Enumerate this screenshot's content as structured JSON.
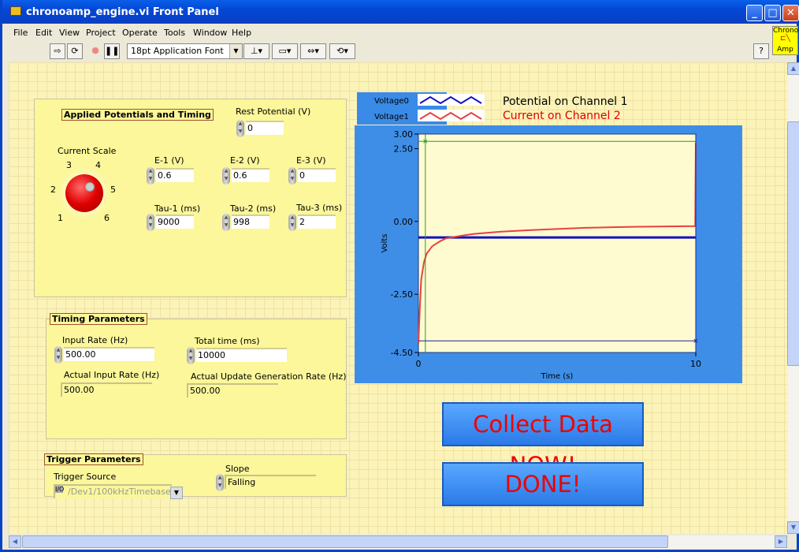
{
  "window": {
    "title": "chronoamp_engine.vi Front Panel"
  },
  "menu": [
    "File",
    "Edit",
    "View",
    "Project",
    "Operate",
    "Tools",
    "Window",
    "Help"
  ],
  "toolbar": {
    "font": "18pt Application Font",
    "help": "?"
  },
  "vi_icon": {
    "top": "Chrono",
    "bottom": "Amp"
  },
  "applied": {
    "title": "Applied Potentials and Timing",
    "rest_label": "Rest Potential (V)",
    "rest_value": "0",
    "knob": {
      "label": "Current Scale",
      "ticks": [
        "1",
        "2",
        "3",
        "4",
        "5",
        "6"
      ],
      "value": 4
    },
    "e1_label": "E-1 (V)",
    "e1": "0.6",
    "e2_label": "E-2 (V)",
    "e2": "0.6",
    "e3_label": "E-3 (V)",
    "e3": "0",
    "tau1_label": "Tau-1 (ms)",
    "tau1": "9000",
    "tau2_label": "Tau-2 (ms)",
    "tau2": "998",
    "tau3_label": "Tau-3 (ms)",
    "tau3": "2"
  },
  "timing": {
    "title": "Timing Parameters",
    "input_rate_label": "Input Rate (Hz)",
    "input_rate": "500.00",
    "total_time_label": "Total time (ms)",
    "total_time": "10000",
    "actual_input_label": "Actual Input Rate (Hz)",
    "actual_input": "500.00",
    "actual_update_label": "Actual Update Generation Rate (Hz)",
    "actual_update": "500.00"
  },
  "trigger": {
    "title": "Trigger Parameters",
    "source_label": "Trigger Source",
    "source": "/Dev1/100kHzTimebase",
    "slope_label": "Slope",
    "slope": "Falling"
  },
  "buttons": {
    "collect": "Collect Data NOW!",
    "done": "DONE!"
  },
  "chart_data": {
    "type": "line",
    "xlabel": "Time (s)",
    "ylabel": "Volts",
    "xlim": [
      0,
      10
    ],
    "ylim": [
      -4.5,
      3.0
    ],
    "xticks": [
      "0",
      "10"
    ],
    "yticks": [
      "3.00",
      "2.50",
      "0.00",
      "-2.50",
      "-4.50"
    ],
    "legend": [
      "Voltage0",
      "Voltage1"
    ],
    "annotations": [
      {
        "text": "Potential on Channel 1",
        "color": "#000000"
      },
      {
        "text": "Current on Channel 2",
        "color": "#e00000"
      }
    ],
    "series": [
      {
        "name": "Voltage0",
        "color": "#1010c0",
        "x": [
          0,
          10
        ],
        "y": [
          -0.55,
          -0.55
        ]
      },
      {
        "name": "Voltage1",
        "color": "#e84040",
        "x": [
          0,
          0.05,
          0.1,
          0.2,
          0.3,
          0.5,
          0.8,
          1,
          1.5,
          2,
          3,
          4,
          5,
          6,
          7,
          8,
          9,
          9.98,
          10
        ],
        "y": [
          -4.2,
          -3.0,
          -2.0,
          -1.4,
          -1.1,
          -0.85,
          -0.67,
          -0.58,
          -0.5,
          -0.43,
          -0.35,
          -0.3,
          -0.26,
          -0.22,
          -0.2,
          -0.18,
          -0.17,
          -0.16,
          2.7
        ]
      }
    ],
    "cursors": [
      {
        "color": "#2a9a2a",
        "x": 0.25,
        "y": 2.75
      },
      {
        "color": "#2020a0",
        "x": 10,
        "y": -4.1
      }
    ]
  }
}
